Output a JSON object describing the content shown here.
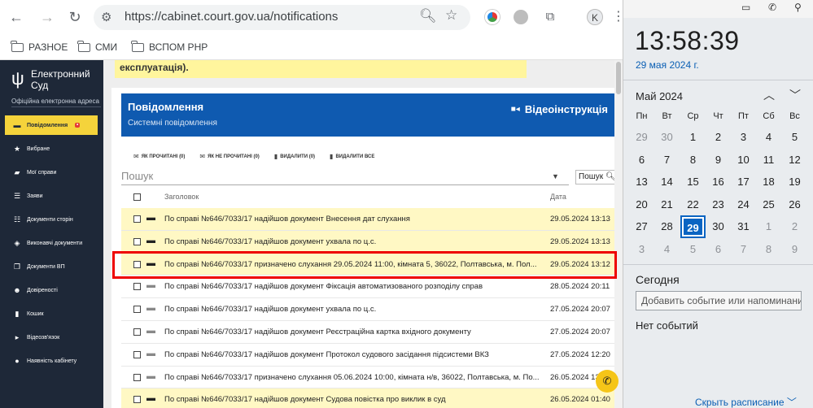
{
  "browser": {
    "url": "https://cabinet.court.gov.ua/notifications",
    "profile_initial": "K",
    "bookmarks": [
      "РАЗНОЕ",
      "СМИ",
      "ВСПОМ PHP"
    ]
  },
  "sidebar": {
    "logo_title": "Електронний Суд",
    "logo_sub": "Офіційна електронна адреса",
    "items": [
      {
        "label": "Повідомлення",
        "icon": "chat-icon",
        "active": true
      },
      {
        "label": "Вибране",
        "icon": "star-icon"
      },
      {
        "label": "Мої справи",
        "icon": "folder-icon"
      },
      {
        "label": "Заяви",
        "icon": "list-icon"
      },
      {
        "label": "Документи сторін",
        "icon": "doc-list-icon"
      },
      {
        "label": "Виконавчі документи",
        "icon": "layers-icon"
      },
      {
        "label": "Документи ВП",
        "icon": "copy-icon"
      },
      {
        "label": "Довіреності",
        "icon": "users-icon"
      },
      {
        "label": "Кошик",
        "icon": "trash-icon"
      },
      {
        "label": "Відеозв'язок",
        "icon": "video-icon"
      },
      {
        "label": "Наявність кабінету",
        "icon": "person-icon"
      }
    ]
  },
  "main": {
    "banner": "експлуатація).",
    "panel_title": "Повідомлення",
    "panel_sub": "Системні повідомлення",
    "video_label": "Відеоінструкція",
    "actions": [
      "ЯК ПРОЧИТАНІ (0)",
      "ЯК НЕ ПРОЧИТАНІ (0)",
      "ВИДАЛИТИ (0)",
      "ВИДАЛИТИ ВСЕ"
    ],
    "search_placeholder": "Пошук",
    "search_button": "Пошук",
    "col_title": "Заголовок",
    "col_date": "Дата",
    "rows": [
      {
        "title": "По справі №646/7033/17 надійшов документ Внесення дат слухання",
        "date": "29.05.2024 13:13",
        "unread": true
      },
      {
        "title": "По справі №646/7033/17 надійшов документ ухвала по ц.с.",
        "date": "29.05.2024 13:13",
        "unread": true
      },
      {
        "title": "По справі №646/7033/17 призначено слухання 29.05.2024 11:00, кімната 5, 36022, Полтавська, м. Пол...",
        "date": "29.05.2024 13:12",
        "unread": true
      },
      {
        "title": "По справі №646/7033/17 надійшов документ Фіксація автоматизованого розподілу справ",
        "date": "28.05.2024 20:11",
        "unread": false
      },
      {
        "title": "По справі №646/7033/17 надійшов документ ухвала по ц.с.",
        "date": "27.05.2024 20:07",
        "unread": false
      },
      {
        "title": "По справі №646/7033/17 надійшов документ Реєстраційна картка вхідного документу",
        "date": "27.05.2024 20:07",
        "unread": false
      },
      {
        "title": "По справі №646/7033/17 надійшов документ Протокол судового засідання підсистеми ВКЗ",
        "date": "27.05.2024 12:20",
        "unread": false
      },
      {
        "title": "По справі №646/7033/17 призначено слухання 05.06.2024 10:00, кімната н/в, 36022, Полтавська, м. По...",
        "date": "26.05.2024 13:07",
        "unread": false
      },
      {
        "title": "По справі №646/7033/17 надійшов документ Судова повістка про виклик в суд",
        "date": "26.05.2024 01:40",
        "unread": true
      }
    ]
  },
  "calendar": {
    "time": "13:58:39",
    "date": "29 мая 2024 г.",
    "month": "Май 2024",
    "dow": [
      "Пн",
      "Вт",
      "Ср",
      "Чт",
      "Пт",
      "Сб",
      "Вс"
    ],
    "weeks": [
      [
        "29",
        "30",
        "1",
        "2",
        "3",
        "4",
        "5"
      ],
      [
        "6",
        "7",
        "8",
        "9",
        "10",
        "11",
        "12"
      ],
      [
        "13",
        "14",
        "15",
        "16",
        "17",
        "18",
        "19"
      ],
      [
        "20",
        "21",
        "22",
        "23",
        "24",
        "25",
        "26"
      ],
      [
        "27",
        "28",
        "29",
        "30",
        "31",
        "1",
        "2"
      ],
      [
        "3",
        "4",
        "5",
        "6",
        "7",
        "8",
        "9"
      ]
    ],
    "today_label": "Сегодня",
    "event_placeholder": "Добавить событие или напоминание",
    "no_events": "Нет событий",
    "hide_schedule": "Скрыть расписание"
  },
  "colors": {
    "sidebar_bg": "#1e2838",
    "accent_yellow": "#f5d33b",
    "panel_blue": "#0f5ab0",
    "unread_row": "#fff8c4",
    "highlight_red": "#e00000",
    "today_blue": "#0a64c2"
  }
}
